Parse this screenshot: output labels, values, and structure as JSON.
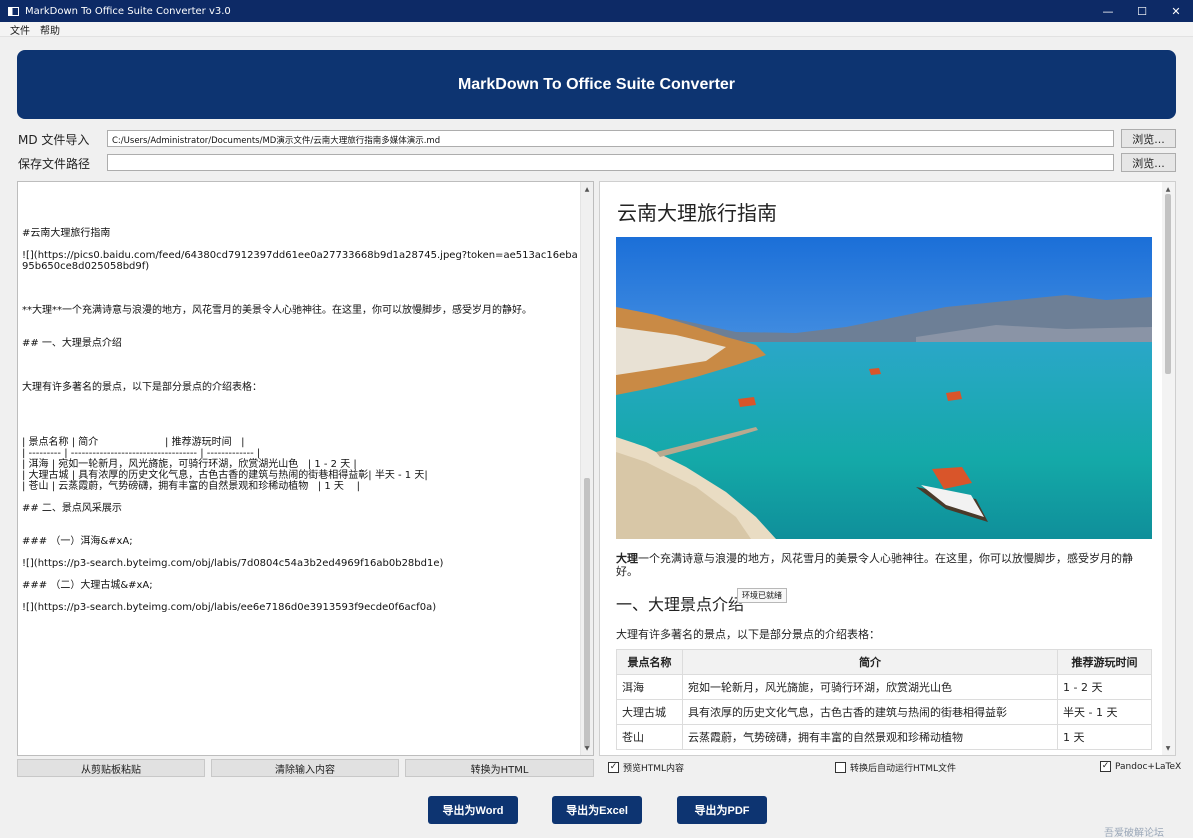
{
  "window": {
    "title": "MarkDown To Office Suite Converter v3.0",
    "minimize": "—",
    "maximize": "☐",
    "close": "✕"
  },
  "menu": [
    "文件",
    "帮助"
  ],
  "banner": {
    "title": "MarkDown To Office Suite Converter"
  },
  "md_import": {
    "label": "MD 文件导入",
    "value": "C:/Users/Administrator/Documents/MD演示文件/云南大理旅行指南多媒体演示.md",
    "browse": "浏览..."
  },
  "save_path": {
    "label": "保存文件路径",
    "value": "",
    "browse": "浏览..."
  },
  "editor": {
    "text": "#云南大理旅行指南\n\n![](https://pics0.baidu.com/feed/64380cd7912397dd61ee0a27733668b9d1a28745.jpeg?token=ae513ac16eba95b650ce8d025058bd9f)\n\n\n\n**大理**一个充满诗意与浪漫的地方，风花雪月的美景令人心驰神往。在这里，你可以放慢脚步，感受岁月的静好。\n\n\n## 一、大理景点介绍\n\n\n\n大理有许多著名的景点，以下是部分景点的介绍表格：\n\n\n\n\n| 景点名称 | 简介                     | 推荐游玩时间   |\n| --------- | ----------------------------------- | ------------- |\n| 洱海 | 宛如一轮新月，风光旖旎，可骑行环湖，欣赏湖光山色   | 1 - 2 天 |\n| 大理古城 | 具有浓厚的历史文化气息，古色古香的建筑与热闹的街巷相得益彰| 半天 - 1 天|\n| 苍山 | 云蒸霞蔚，气势磅礴，拥有丰富的自然景观和珍稀动植物   | 1 天    |\n\n## 二、景点风采展示\n\n\n### （一）洱海&#xA;\n\n![](https://p3-search.byteimg.com/obj/labis/7d0804c54a3b2ed4969f16ab0b28bd1e)\n\n### （二）大理古城&#xA;\n\n![](https://p3-search.byteimg.com/obj/labis/ee6e7186d0e3913593f9ecde0f6acf0a)"
  },
  "editor_buttons": [
    "从剪贴板粘贴",
    "清除输入内容",
    "转换为HTML"
  ],
  "preview": {
    "h1": "云南大理旅行指南",
    "para_bold": "大理",
    "para_rest": "一个充满诗意与浪漫的地方，风花雪月的美景令人心驰神往。在这里，你可以放慢脚步，感受岁月的静好。",
    "h2": "一、大理景点介绍",
    "tooltip": "环境已就绪",
    "intro": "大理有许多著名的景点，以下是部分景点的介绍表格：",
    "table": {
      "headers": [
        "景点名称",
        "简介",
        "推荐游玩时间"
      ],
      "rows": [
        [
          "洱海",
          "宛如一轮新月，风光旖旎，可骑行环湖，欣赏湖光山色",
          "1 - 2 天"
        ],
        [
          "大理古城",
          "具有浓厚的历史文化气息，古色古香的建筑与热闹的街巷相得益彰",
          "半天 - 1 天"
        ],
        [
          "苍山",
          "云蒸霞蔚，气势磅礴，拥有丰富的自然景观和珍稀动植物",
          "1 天"
        ]
      ]
    }
  },
  "options": {
    "preview_html": {
      "label": "预览HTML内容",
      "checked": true
    },
    "auto_run_html": {
      "label": "转换后自动运行HTML文件",
      "checked": false
    },
    "pandoc_latex": {
      "label": "Pandoc+LaTeX",
      "checked": true
    }
  },
  "export_buttons": [
    "导出为Word",
    "导出为Excel",
    "导出为PDF"
  ],
  "watermark": "吾爱破解论坛",
  "colors": {
    "primary": "#0d3471",
    "titlebar": "#0d2a66"
  }
}
